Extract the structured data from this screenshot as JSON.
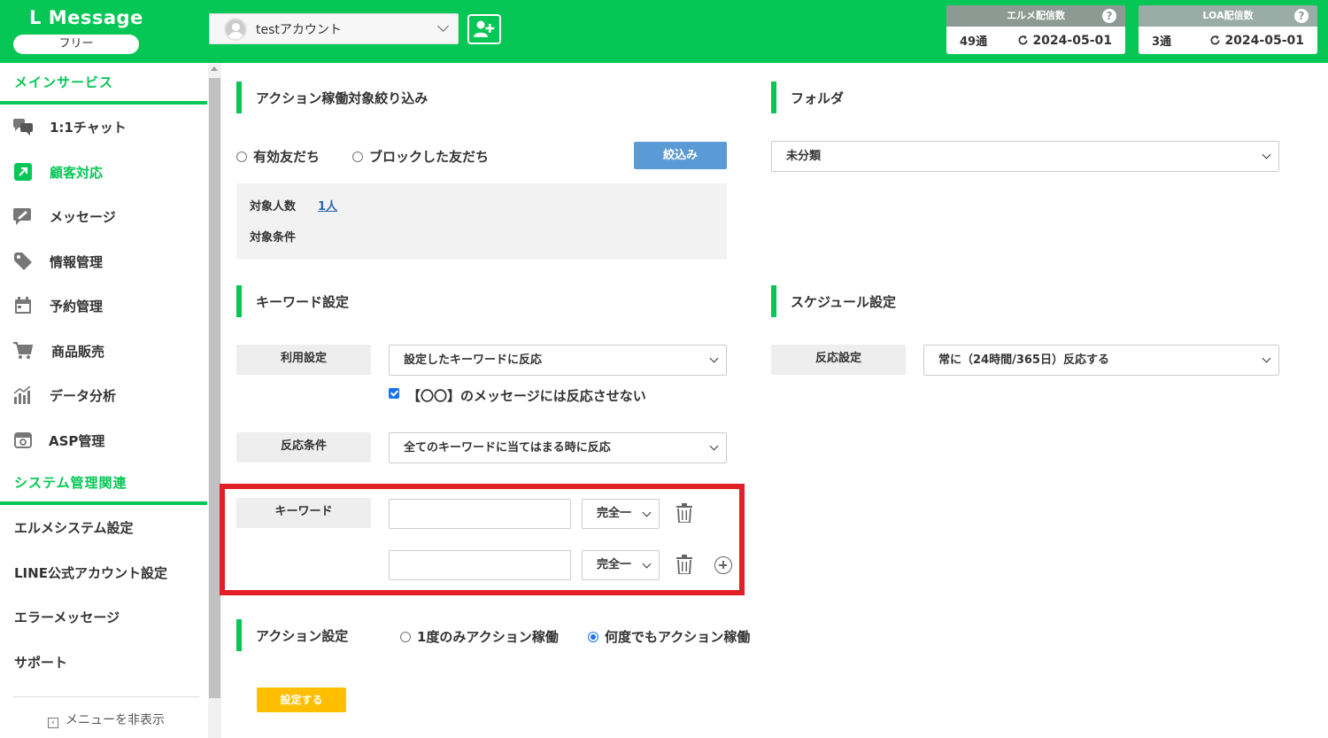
{
  "header": {
    "logo": "L Message",
    "plan": "フリー",
    "account": "testアカウント",
    "quotas": [
      {
        "title": "エルメ配信数",
        "count": "49通",
        "date": "2024-05-01"
      },
      {
        "title": "LOA配信数",
        "count": "3通",
        "date": "2024-05-01"
      }
    ],
    "help": "?"
  },
  "sidebar": {
    "main_section": "メインサービス",
    "items": [
      {
        "label": "1:1チャット",
        "icon": "chat-icon"
      },
      {
        "label": "顧客対応",
        "icon": "external-link-icon"
      },
      {
        "label": "メッセージ",
        "icon": "message-edit-icon"
      },
      {
        "label": "情報管理",
        "icon": "tag-icon"
      },
      {
        "label": "予約管理",
        "icon": "calendar-icon"
      },
      {
        "label": "商品販売",
        "icon": "cart-icon"
      },
      {
        "label": "データ分析",
        "icon": "chart-icon"
      },
      {
        "label": "ASP管理",
        "icon": "asp-icon"
      }
    ],
    "system_section": "システム管理関連",
    "system_items": [
      "エルメシステム設定",
      "LINE公式アカウント設定",
      "エラーメッセージ",
      "サポート"
    ],
    "hide_menu": "メニューを非表示"
  },
  "filter": {
    "heading": "アクション稼働対象絞り込み",
    "option_active": "有効友だち",
    "option_blocked": "ブロックした友だち",
    "button": "絞込み",
    "target_count_label": "対象人数",
    "target_count": "1人",
    "target_condition_label": "対象条件"
  },
  "folder": {
    "heading": "フォルダ",
    "selected": "未分類"
  },
  "keyword": {
    "heading": "キーワード設定",
    "usage_label": "利用設定",
    "usage_value": "設定したキーワードに反応",
    "ignore_checkbox": "【〇〇】のメッセージには反応させない",
    "condition_label": "反応条件",
    "condition_value": "全てのキーワードに当てはまる時に反応",
    "keyword_label": "キーワード",
    "match_1": "完全一",
    "match_2": "完全一"
  },
  "schedule": {
    "heading": "スケジュール設定",
    "response_label": "反応設定",
    "response_value": "常に（24時間/365日）反応する"
  },
  "action": {
    "heading": "アクション設定",
    "option_once": "1度のみアクション稼働",
    "option_always": "何度でもアクション稼働",
    "submit": "設定する"
  }
}
